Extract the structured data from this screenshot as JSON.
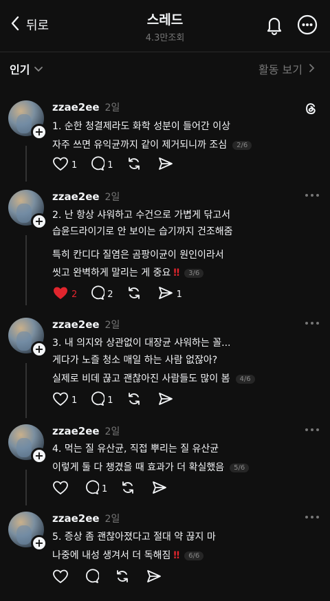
{
  "header": {
    "back_label": "뒤로",
    "title": "스레드",
    "views": "4.3만조회"
  },
  "filter": {
    "sort_label": "인기",
    "activity_label": "활동 보기"
  },
  "colors": {
    "background": "#101010",
    "text": "#f3f5f7",
    "muted": "#777777",
    "like": "#e0252d"
  },
  "posts": [
    {
      "username": "zzae2ee",
      "time": "2일",
      "lines": [
        "1. 순한 청결제라도 화학 성분이 들어간 이상",
        "자주 쓰면 유익균까지 같이 제거되니까 조심"
      ],
      "page": "2/6",
      "likes": "1",
      "comments": "1",
      "reposts": "",
      "shares": ""
    },
    {
      "username": "zzae2ee",
      "time": "2일",
      "lines": [
        "2. 난 항상 샤워하고 수건으로 가볍게 닦고서",
        "습윤드라이기로 안 보이는 습기까지 건조해줌",
        "특히 칸디다 질염은 곰팡이균이 원인이라서",
        "씻고 완벽하게 말리는 게 중요"
      ],
      "bang": "‼",
      "page": "3/6",
      "likes": "2",
      "comments": "2",
      "reposts": "",
      "shares": "1"
    },
    {
      "username": "zzae2ee",
      "time": "2일",
      "lines": [
        "3. 내 의지와 상관없이 대장균 샤워하는 꼴...",
        "게다가 노즐 청소 매일 하는 사람 없잖아?",
        "실제로 비데 끊고 괜찮아진 사람들도 많이 봄"
      ],
      "page": "4/6",
      "likes": "1",
      "comments": "1",
      "reposts": "",
      "shares": ""
    },
    {
      "username": "zzae2ee",
      "time": "2일",
      "lines": [
        "4. 먹는 질 유산균, 직접 뿌리는 질 유산균",
        "이렇게 둘 다 챙겼을 때 효과가 더 확실했음"
      ],
      "page": "5/6",
      "likes": "",
      "comments": "1",
      "reposts": "",
      "shares": ""
    },
    {
      "username": "zzae2ee",
      "time": "2일",
      "lines": [
        "5. 증상 좀 괜찮아졌다고 절대 약 끊지 마",
        "나중에 내성 생겨서 더 독해짐"
      ],
      "bang": "‼",
      "page": "6/6",
      "likes": "",
      "comments": "",
      "reposts": "",
      "shares": ""
    }
  ]
}
